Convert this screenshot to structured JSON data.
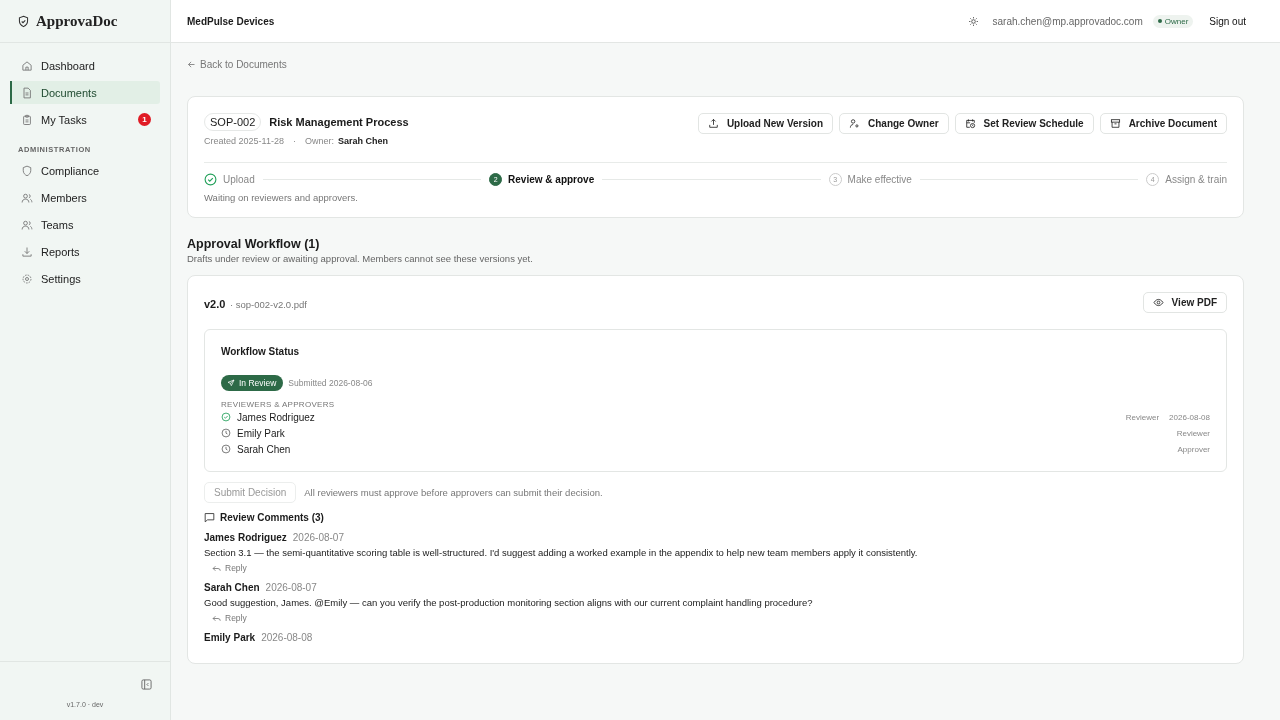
{
  "sidebar": {
    "logo": "ApprovaDoc",
    "items": [
      {
        "label": "Dashboard",
        "kind": "home",
        "selected": false
      },
      {
        "label": "Documents",
        "kind": "file",
        "selected": true
      },
      {
        "label": "My Tasks",
        "kind": "clipboard",
        "selected": false,
        "badge": "1"
      }
    ],
    "section_label": "ADMINISTRATION",
    "admin_items": [
      {
        "label": "Compliance",
        "kind": "shield",
        "selected": false
      },
      {
        "label": "Members",
        "kind": "users",
        "selected": false
      },
      {
        "label": "Teams",
        "kind": "team",
        "selected": false
      },
      {
        "label": "Reports",
        "kind": "download",
        "selected": false
      },
      {
        "label": "Settings",
        "kind": "gear",
        "selected": false
      }
    ],
    "version": "v1.7.0 · dev"
  },
  "header": {
    "org": "MedPulse Devices",
    "email": "sarah.chen@mp.approvadoc.com",
    "role": "Owner",
    "sign_out": "Sign out"
  },
  "back_link": "Back to Documents",
  "document": {
    "code": "SOP-002",
    "title": "Risk Management Process",
    "created": "Created 2025-11-28",
    "separator": "·",
    "owner_label": "Owner:",
    "owner": "Sarah Chen",
    "actions": [
      {
        "label": "Upload New Version",
        "kind": "upload"
      },
      {
        "label": "Change Owner",
        "kind": "user"
      },
      {
        "label": "Set Review Schedule",
        "kind": "calendar"
      },
      {
        "label": "Archive Document",
        "kind": "archive"
      }
    ],
    "steps": [
      {
        "label": "Upload",
        "kind": "done"
      },
      {
        "number": "2",
        "label": "Review & approve",
        "kind": "current"
      },
      {
        "number": "3",
        "label": "Make effective",
        "kind": "pending"
      },
      {
        "number": "4",
        "label": "Assign & train",
        "kind": "pending"
      }
    ],
    "step_note": "Waiting on reviewers and approvers."
  },
  "workflow": {
    "title": "Approval Workflow (1)",
    "subtitle": "Drafts under review or awaiting approval. Members cannot see these versions yet.",
    "version": "v2.0",
    "file": "· sop-002-v2.0.pdf",
    "view_button": "View PDF",
    "status_title": "Workflow Status",
    "status": "In Review",
    "submitted": "Submitted 2026-08-06",
    "people_label": "REVIEWERS & APPROVERS",
    "people": [
      {
        "name": "James Rodriguez",
        "approved": true,
        "role": "Reviewer",
        "date": "2026-08-08"
      },
      {
        "name": "Emily Park",
        "approved": false,
        "role": "Reviewer"
      },
      {
        "name": "Sarah Chen",
        "approved": false,
        "role": "Approver"
      }
    ],
    "submit_button": {
      "label": "Submit Decision",
      "disabled": true
    },
    "submit_note": "All reviewers must approve before approvers can submit their decision.",
    "comments_title": "Review Comments (3)",
    "comments": [
      {
        "author": "James Rodriguez",
        "date": "2026-08-07",
        "text": "Section 3.1 — the semi-quantitative scoring table is well-structured. I'd suggest adding a worked example in the appendix to help new team members apply it consistently.",
        "reply": "Reply"
      },
      {
        "author": "Sarah Chen",
        "date": "2026-08-07",
        "text": "Good suggestion, James. @Emily — can you verify the post-production monitoring section aligns with our current complaint handling procedure?",
        "reply": "Reply"
      },
      {
        "author": "Emily Park",
        "date": "2026-08-08"
      }
    ]
  }
}
